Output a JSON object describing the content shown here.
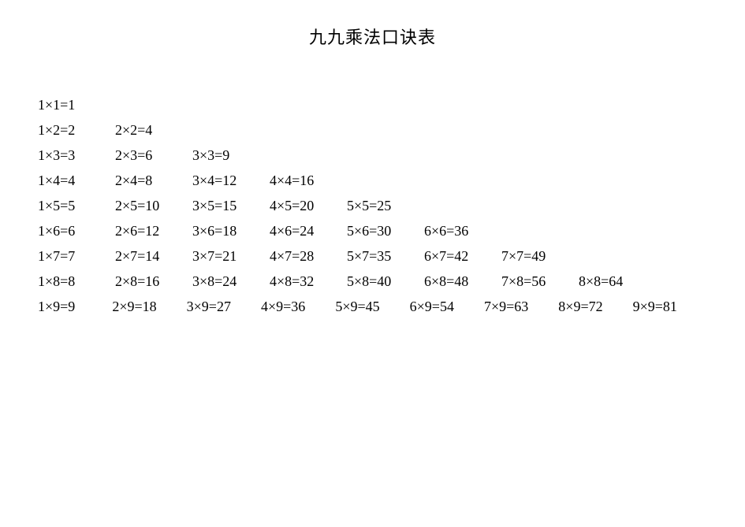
{
  "title": "九九乘法口诀表",
  "chart_data": {
    "type": "table",
    "title": "九九乘法口诀表",
    "rows": [
      [
        {
          "a": 1,
          "b": 1,
          "p": 1
        }
      ],
      [
        {
          "a": 1,
          "b": 2,
          "p": 2
        },
        {
          "a": 2,
          "b": 2,
          "p": 4
        }
      ],
      [
        {
          "a": 1,
          "b": 3,
          "p": 3
        },
        {
          "a": 2,
          "b": 3,
          "p": 6
        },
        {
          "a": 3,
          "b": 3,
          "p": 9
        }
      ],
      [
        {
          "a": 1,
          "b": 4,
          "p": 4
        },
        {
          "a": 2,
          "b": 4,
          "p": 8
        },
        {
          "a": 3,
          "b": 4,
          "p": 12
        },
        {
          "a": 4,
          "b": 4,
          "p": 16
        }
      ],
      [
        {
          "a": 1,
          "b": 5,
          "p": 5
        },
        {
          "a": 2,
          "b": 5,
          "p": 10
        },
        {
          "a": 3,
          "b": 5,
          "p": 15
        },
        {
          "a": 4,
          "b": 5,
          "p": 20
        },
        {
          "a": 5,
          "b": 5,
          "p": 25
        }
      ],
      [
        {
          "a": 1,
          "b": 6,
          "p": 6
        },
        {
          "a": 2,
          "b": 6,
          "p": 12
        },
        {
          "a": 3,
          "b": 6,
          "p": 18
        },
        {
          "a": 4,
          "b": 6,
          "p": 24
        },
        {
          "a": 5,
          "b": 6,
          "p": 30
        },
        {
          "a": 6,
          "b": 6,
          "p": 36
        }
      ],
      [
        {
          "a": 1,
          "b": 7,
          "p": 7
        },
        {
          "a": 2,
          "b": 7,
          "p": 14
        },
        {
          "a": 3,
          "b": 7,
          "p": 21
        },
        {
          "a": 4,
          "b": 7,
          "p": 28
        },
        {
          "a": 5,
          "b": 7,
          "p": 35
        },
        {
          "a": 6,
          "b": 7,
          "p": 42
        },
        {
          "a": 7,
          "b": 7,
          "p": 49
        }
      ],
      [
        {
          "a": 1,
          "b": 8,
          "p": 8
        },
        {
          "a": 2,
          "b": 8,
          "p": 16
        },
        {
          "a": 3,
          "b": 8,
          "p": 24
        },
        {
          "a": 4,
          "b": 8,
          "p": 32
        },
        {
          "a": 5,
          "b": 8,
          "p": 40
        },
        {
          "a": 6,
          "b": 8,
          "p": 48
        },
        {
          "a": 7,
          "b": 8,
          "p": 56
        },
        {
          "a": 8,
          "b": 8,
          "p": 64
        }
      ],
      [
        {
          "a": 1,
          "b": 9,
          "p": 9
        },
        {
          "a": 2,
          "b": 9,
          "p": 18
        },
        {
          "a": 3,
          "b": 9,
          "p": 27
        },
        {
          "a": 4,
          "b": 9,
          "p": 36
        },
        {
          "a": 5,
          "b": 9,
          "p": 45
        },
        {
          "a": 6,
          "b": 9,
          "p": 54
        },
        {
          "a": 7,
          "b": 9,
          "p": 63
        },
        {
          "a": 8,
          "b": 9,
          "p": 72
        },
        {
          "a": 9,
          "b": 9,
          "p": 81
        }
      ]
    ]
  }
}
